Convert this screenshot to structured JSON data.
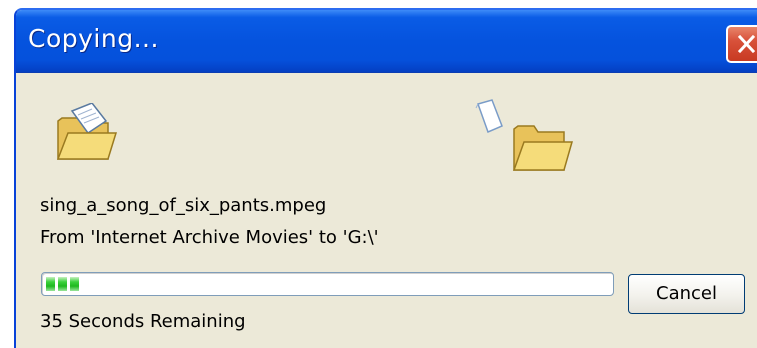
{
  "window": {
    "title": "Copying..."
  },
  "copy": {
    "file_name": "sing_a_song_of_six_pants.mpeg",
    "from_to": "From 'Internet Archive Movies' to 'G:\\'",
    "time_remaining": "35 Seconds Remaining",
    "progress_chunks": 3
  },
  "buttons": {
    "cancel_label": "Cancel"
  },
  "icons": {
    "source": "source-folder-icon",
    "destination": "destination-folder-icon",
    "flying_document": "document-icon",
    "close": "close-icon"
  },
  "colors": {
    "titlebar": "#0553de",
    "dialog_background": "#ece9d8",
    "progress_green": "#1fb81f",
    "close_red": "#d8513a"
  }
}
